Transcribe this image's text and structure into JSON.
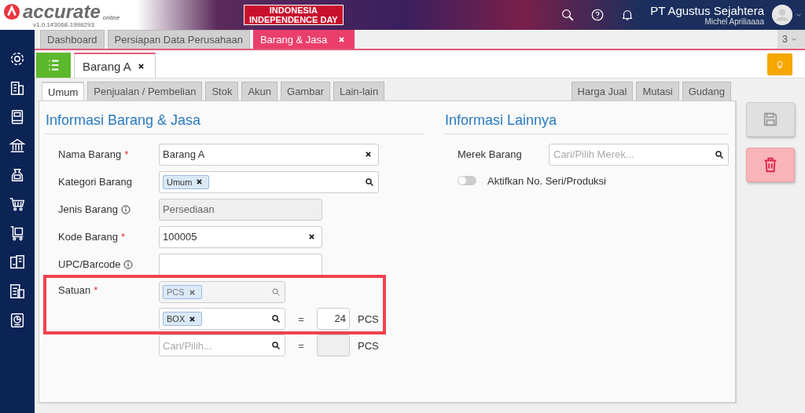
{
  "header": {
    "logo": "accurate",
    "logo_sub": "online",
    "version": "v1.0.1#3068-1998293",
    "banner": [
      "INDONESIA",
      "INDEPENDENCE DAY"
    ],
    "company": "PT Agustus Sejahtera",
    "user": "Michel Apriliaaaa"
  },
  "doc_tabs": [
    {
      "label": "Dashboard",
      "selected": false,
      "closable": false
    },
    {
      "label": "Persiapan Data Perusahaan",
      "selected": false,
      "closable": false
    },
    {
      "label": "Barang & Jasa",
      "selected": true,
      "closable": true
    }
  ],
  "doc_tab_count": "3",
  "sub_tabs": [
    {
      "label": "Barang A",
      "selected": true
    }
  ],
  "form_tabs_left": [
    {
      "label": "Umum",
      "selected": true
    },
    {
      "label": "Penjualan / Pembelian",
      "selected": false
    },
    {
      "label": "Stok",
      "selected": false
    },
    {
      "label": "Akun",
      "selected": false
    },
    {
      "label": "Gambar",
      "selected": false
    },
    {
      "label": "Lain-lain",
      "selected": false
    }
  ],
  "form_tabs_right": [
    {
      "label": "Harga Jual",
      "selected": false
    },
    {
      "label": "Mutasi",
      "selected": false
    },
    {
      "label": "Gudang",
      "selected": false
    }
  ],
  "info_section": {
    "title": "Informasi Barang & Jasa",
    "fields": [
      {
        "label": "Nama Barang",
        "required_mark": "*",
        "info": false,
        "kind": "text",
        "value": "Barang A"
      },
      {
        "label": "Kategori Barang",
        "info": false,
        "kind": "tags",
        "tags": [
          "Umum"
        ]
      },
      {
        "label": "Jenis Barang",
        "info": true,
        "kind": "readonly",
        "value": "Persediaan"
      },
      {
        "label": "Kode Barang",
        "required_mark": "*",
        "info": false,
        "kind": "text",
        "value": "100005"
      },
      {
        "label": "UPC/Barcode",
        "info": true,
        "kind": "empty"
      }
    ]
  },
  "units": {
    "label": "Satuan",
    "required_mark": "*",
    "highlight": true,
    "rows": [
      {
        "tag": "PCS",
        "disabled": true
      },
      {
        "tag": "BOX",
        "disabled": false,
        "equals": "=",
        "ratio": "24",
        "unit": "PCS"
      },
      {
        "placeholder": "Cari/Pilih...",
        "disabled": false,
        "equals": "=",
        "unit": "PCS"
      }
    ]
  },
  "other_section": {
    "title": "Informasi Lainnya",
    "brand": {
      "label": "Merek Barang",
      "placeholder": "Cari/Pilih Merek..."
    },
    "toggle": {
      "label": "Aktifkan No. Seri/Produksi",
      "on": false
    }
  }
}
